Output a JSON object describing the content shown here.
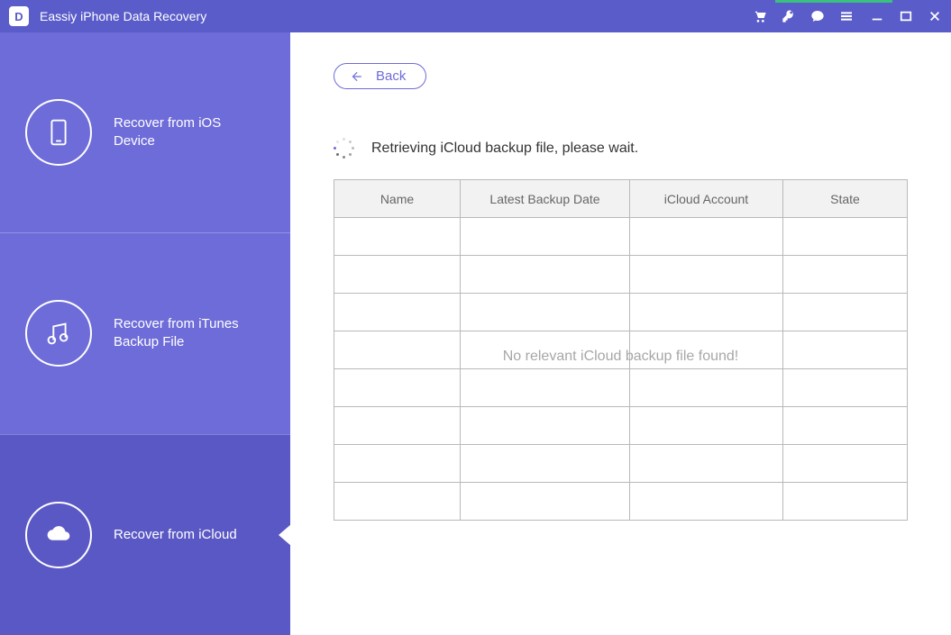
{
  "app": {
    "title": "Eassiy iPhone Data Recovery",
    "logo_letter": "D"
  },
  "sidebar": {
    "items": [
      {
        "label": "Recover from iOS Device"
      },
      {
        "label": "Recover from iTunes Backup File"
      },
      {
        "label": "Recover from iCloud"
      }
    ]
  },
  "content": {
    "back_label": "Back",
    "status_text": "Retrieving iCloud backup file, please wait.",
    "table": {
      "headers": [
        "Name",
        "Latest Backup Date",
        "iCloud Account",
        "State"
      ],
      "empty_message": "No relevant iCloud backup file found!"
    }
  }
}
